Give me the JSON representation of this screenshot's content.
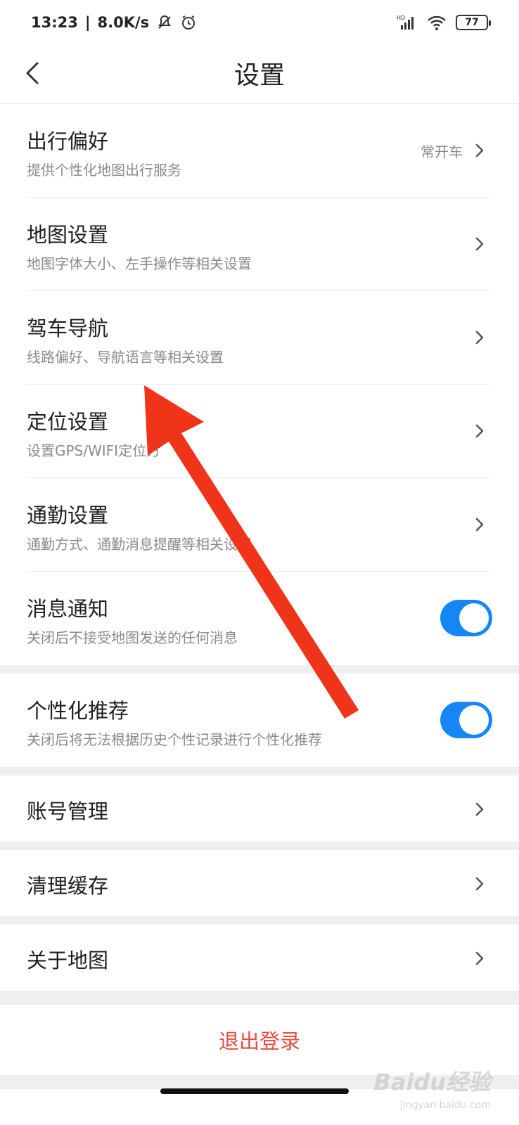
{
  "statusbar": {
    "time": "13:23",
    "net_speed": "8.0K/s",
    "signal_label": "HD",
    "battery": "77"
  },
  "navbar": {
    "title": "设置"
  },
  "rows": [
    {
      "title": "出行偏好",
      "sub": "提供个性化地图出行服务",
      "value": "常开车"
    },
    {
      "title": "地图设置",
      "sub": "地图字体大小、左手操作等相关设置"
    },
    {
      "title": "驾车导航",
      "sub": "线路偏好、导航语言等相关设置"
    },
    {
      "title": "定位设置",
      "sub": "设置GPS/WIFI定位方"
    },
    {
      "title": "通勤设置",
      "sub": "通勤方式、通勤消息提醒等相关设置"
    },
    {
      "title": "消息通知",
      "sub": "关闭后不接受地图发送的任何消息",
      "toggle": true
    }
  ],
  "personal": {
    "title": "个性化推荐",
    "sub": "关闭后将无法根据历史个性记录进行个性化推荐",
    "toggle": true
  },
  "singles": [
    {
      "title": "账号管理"
    },
    {
      "title": "清理缓存"
    },
    {
      "title": "关于地图"
    }
  ],
  "logout": {
    "label": "退出登录"
  },
  "watermark": {
    "text": "Baidu经验",
    "sub": "jingyan.baidu.com"
  },
  "colors": {
    "accent": "#1587f5",
    "danger": "#e54b3c",
    "arrow": "#f0341a"
  }
}
